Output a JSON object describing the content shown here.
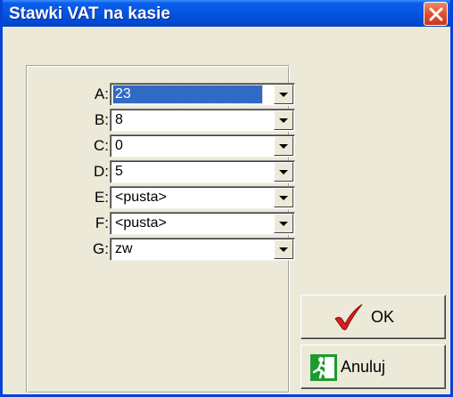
{
  "window": {
    "title": "Stawki VAT na kasie"
  },
  "rates": [
    {
      "label": "A:",
      "value": "23"
    },
    {
      "label": "B:",
      "value": "8"
    },
    {
      "label": "C:",
      "value": "0"
    },
    {
      "label": "D:",
      "value": "5"
    },
    {
      "label": "E:",
      "value": "<pusta>"
    },
    {
      "label": "F:",
      "value": "<pusta>"
    },
    {
      "label": "G:",
      "value": "zw"
    }
  ],
  "selected_rate": "A",
  "buttons": {
    "ok": "OK",
    "cancel": "Anuluj"
  },
  "colors": {
    "titlebar": "#0554E3",
    "selection": "#316AC5",
    "dialog_bg": "#ECE9D8",
    "close": "#E2502C",
    "ok_check": "#D32020",
    "cancel_icon": "#1E9A2E"
  },
  "icons": {
    "close": "close-icon",
    "ok": "checkmark-icon",
    "cancel": "exit-door-icon"
  }
}
